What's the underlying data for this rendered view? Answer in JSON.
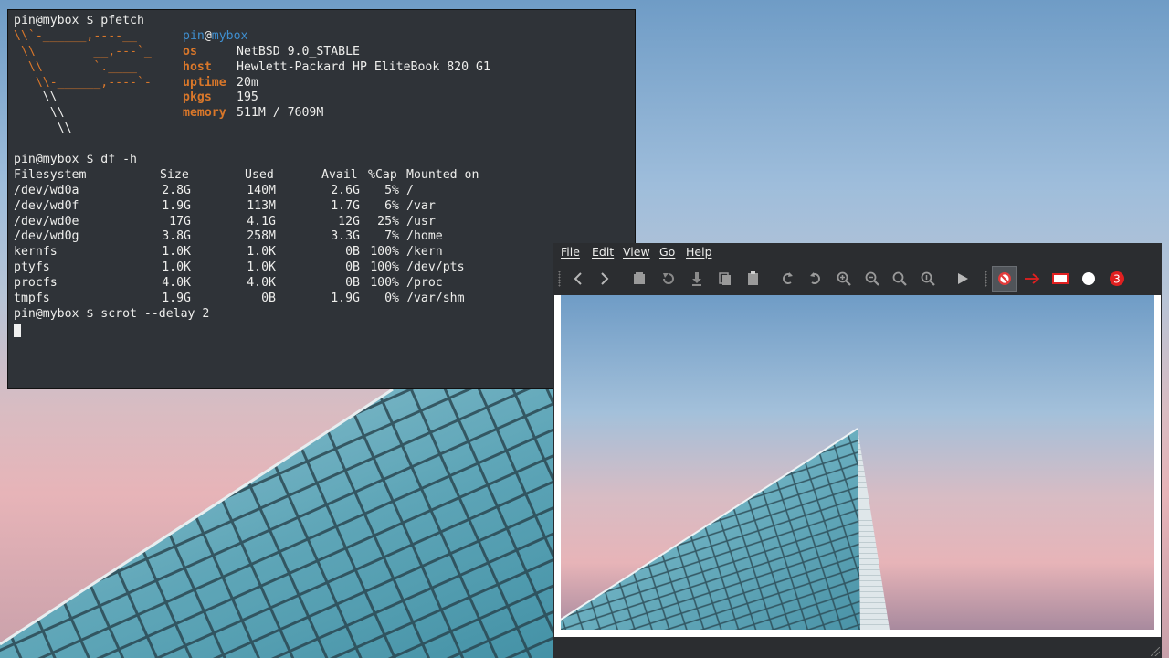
{
  "terminal": {
    "lines": [
      {
        "prompt": "pin@mybox $ pfetch"
      },
      {
        "logo": "\\\\`-______,----__",
        "key": "",
        "value": ""
      },
      {
        "logo": " \\\\        __,---`_",
        "key": "os",
        "value": "NetBSD 9.0_STABLE"
      },
      {
        "logo": "  \\\\       `.____",
        "key": "host",
        "value": "Hewlett-Packard HP EliteBook 820 G1"
      },
      {
        "logo": "   \\\\-______,----`-",
        "key": "uptime",
        "value": "20m"
      },
      {
        "logo": "    \\\\",
        "key": "pkgs",
        "value": "195"
      },
      {
        "logo": "     \\\\",
        "key": "memory",
        "value": "511M / 7609M"
      },
      {
        "logo": "      \\\\",
        "key": "",
        "value": ""
      }
    ],
    "user_host": {
      "user": "pin",
      "at": "@",
      "host": "mybox"
    },
    "df_prompt": "pin@mybox $ df -h",
    "df_header": [
      "Filesystem",
      "Size",
      "Used",
      "Avail",
      "%Cap",
      "Mounted on"
    ],
    "df_rows": [
      [
        "/dev/wd0a",
        "2.8G",
        "140M",
        "2.6G",
        "5%",
        "/"
      ],
      [
        "/dev/wd0f",
        "1.9G",
        "113M",
        "1.7G",
        "6%",
        "/var"
      ],
      [
        "/dev/wd0e",
        "17G",
        "4.1G",
        "12G",
        "25%",
        "/usr"
      ],
      [
        "/dev/wd0g",
        "3.8G",
        "258M",
        "3.3G",
        "7%",
        "/home"
      ],
      [
        "kernfs",
        "1.0K",
        "1.0K",
        "0B",
        "100%",
        "/kern"
      ],
      [
        "ptyfs",
        "1.0K",
        "1.0K",
        "0B",
        "100%",
        "/dev/pts"
      ],
      [
        "procfs",
        "4.0K",
        "4.0K",
        "0B",
        "100%",
        "/proc"
      ],
      [
        "tmpfs",
        "1.9G",
        "0B",
        "1.9G",
        "0%",
        "/var/shm"
      ]
    ],
    "last_prompt": "pin@mybox $ scrot --delay 2"
  },
  "viewer": {
    "menu": [
      "File",
      "Edit",
      "View",
      "Go",
      "Help"
    ],
    "toolbar": [
      {
        "name": "back-icon",
        "color": "#b8b8b8"
      },
      {
        "name": "forward-icon",
        "color": "#b8b8b8"
      },
      {
        "name": "open-folder-icon",
        "color": "#9a9a9a"
      },
      {
        "name": "reload-icon",
        "color": "#8a8a8a"
      },
      {
        "name": "save-icon",
        "color": "#8a8a8a"
      },
      {
        "name": "copy-icon",
        "color": "#9a9a9a"
      },
      {
        "name": "paste-icon",
        "color": "#9a9a9a"
      },
      {
        "name": "rotate-left-icon",
        "color": "#9a9a9a"
      },
      {
        "name": "rotate-right-icon",
        "color": "#9a9a9a"
      },
      {
        "name": "zoom-in-icon",
        "color": "#9a9a9a"
      },
      {
        "name": "zoom-out-icon",
        "color": "#9a9a9a"
      },
      {
        "name": "zoom-fit-icon",
        "color": "#9a9a9a"
      },
      {
        "name": "zoom-original-icon",
        "color": "#9a9a9a"
      },
      {
        "name": "slideshow-play-icon",
        "color": "#b8b8b8"
      },
      {
        "name": "no-annotation-icon",
        "color": "#e23b3b"
      },
      {
        "name": "arrow-tool-icon",
        "color": "#e02020"
      },
      {
        "name": "rectangle-tool-icon",
        "color": "#e02020"
      },
      {
        "name": "circle-tool-icon",
        "color": "#ffffff"
      },
      {
        "name": "number-tool-icon",
        "color": "#e02020",
        "label": "3"
      }
    ]
  }
}
